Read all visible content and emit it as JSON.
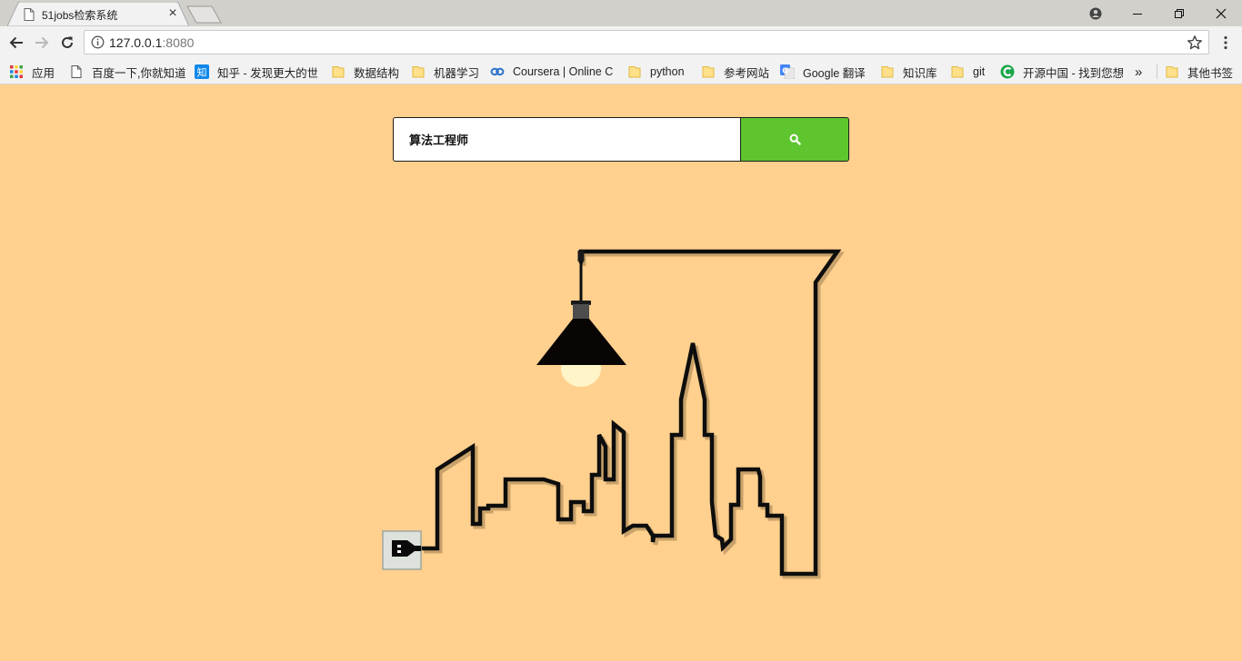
{
  "browser": {
    "tab_title": "51jobs检索系统",
    "tab_close": "×",
    "url_host": "127.0.0.1",
    "url_port": ":8080"
  },
  "bookmarks": [
    {
      "label": "应用",
      "icon": "apps-grid-icon"
    },
    {
      "label": "百度一下,你就知道",
      "icon": "page-icon"
    },
    {
      "label": "知乎 - 发现更大的世",
      "icon": "zhihu-icon"
    },
    {
      "label": "数据结构",
      "icon": "folder-icon"
    },
    {
      "label": "机器学习",
      "icon": "folder-icon"
    },
    {
      "label": "Coursera | Online C",
      "icon": "coursera-icon"
    },
    {
      "label": "python",
      "icon": "folder-icon"
    },
    {
      "label": "参考网站",
      "icon": "folder-icon"
    },
    {
      "label": "Google 翻译",
      "icon": "google-translate-icon"
    },
    {
      "label": "知识库",
      "icon": "folder-icon"
    },
    {
      "label": "git",
      "icon": "folder-icon"
    },
    {
      "label": "开源中国 - 找到您想",
      "icon": "oschina-icon"
    },
    {
      "label": "»",
      "icon": "overflow-chevron-icon"
    },
    {
      "label": "其他书签",
      "icon": "folder-icon"
    }
  ],
  "search": {
    "value": "算法工程师",
    "button_icon": "search-icon"
  },
  "illustration": {
    "icons": [
      "city-skyline-icon",
      "hanging-lamp-icon",
      "power-plug-icon",
      "wall-socket-icon"
    ]
  },
  "colors": {
    "page_background": "#ffd08e",
    "search_button": "#5fc52e",
    "line": "#0d0d0d"
  }
}
